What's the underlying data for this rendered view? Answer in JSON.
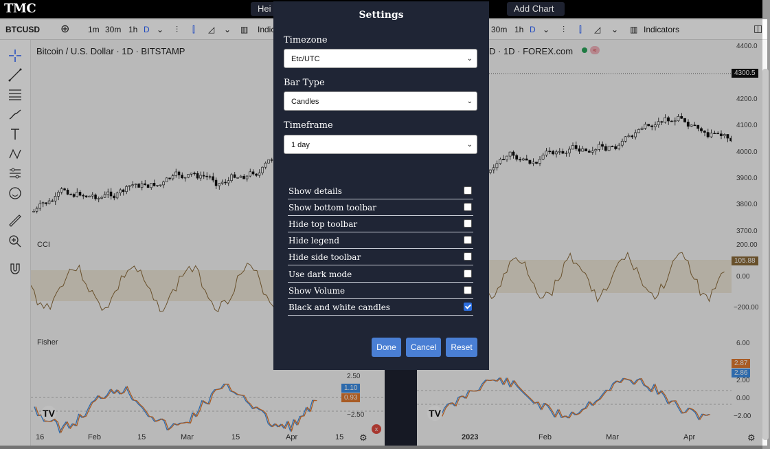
{
  "topbar": {
    "logo": "TMC",
    "partial_button": "Hei",
    "add_chart": "Add Chart"
  },
  "left_chart": {
    "symbol": "BTCUSD",
    "intervals": [
      "1m",
      "30m",
      "1h",
      "D"
    ],
    "indicators_partial": "Indic",
    "title": "Bitcoin / U.S. Dollar · 1D · BITSTAMP",
    "cci_label": "CCI",
    "fisher_label": "Fisher",
    "fisher_axis": [
      "2.50",
      "−2.50"
    ],
    "fisher_badges": [
      "1.10",
      "0.93"
    ],
    "time_axis": [
      "16",
      "Feb",
      "15",
      "Mar",
      "15",
      "Apr",
      "15"
    ]
  },
  "right_chart": {
    "intervals": [
      "30m",
      "1h",
      "D"
    ],
    "indicators": "Indicators",
    "title_partial": "D · 1D · FOREX.com",
    "price_axis": [
      "4400.0",
      "4200.0",
      "4100.0",
      "4000.0",
      "3900.0",
      "3800.0",
      "3700.0"
    ],
    "last_price": "4300.5",
    "cci_axis": [
      "200.00",
      "0.00",
      "−200.00"
    ],
    "cci_badge": "105.88",
    "fisher_axis": [
      "6.00",
      "2.00",
      "0.00",
      "−2.00"
    ],
    "fisher_badges": [
      "2.87",
      "2.86"
    ],
    "time_axis": [
      "2023",
      "Feb",
      "Mar",
      "Apr"
    ]
  },
  "modal": {
    "title": "Settings",
    "timezone_label": "Timezone",
    "timezone_value": "Etc/UTC",
    "bartype_label": "Bar Type",
    "bartype_value": "Candles",
    "timeframe_label": "Timeframe",
    "timeframe_value": "1 day",
    "options": [
      {
        "label": "Show details",
        "checked": false
      },
      {
        "label": "Show bottom toolbar",
        "checked": false
      },
      {
        "label": "Hide top toolbar",
        "checked": false
      },
      {
        "label": "Hide legend",
        "checked": false
      },
      {
        "label": "Hide side toolbar",
        "checked": false
      },
      {
        "label": "Use dark mode",
        "checked": false
      },
      {
        "label": "Show Volume",
        "checked": false
      },
      {
        "label": "Black and white candles",
        "checked": true
      }
    ],
    "done": "Done",
    "cancel": "Cancel",
    "reset": "Reset"
  },
  "colors": {
    "accent": "#4a7fd4",
    "modal_bg": "#1f2535",
    "fisher_blue": "#3d8ee6",
    "fisher_orange": "#e07a30",
    "cci": "#8b6b3a"
  }
}
